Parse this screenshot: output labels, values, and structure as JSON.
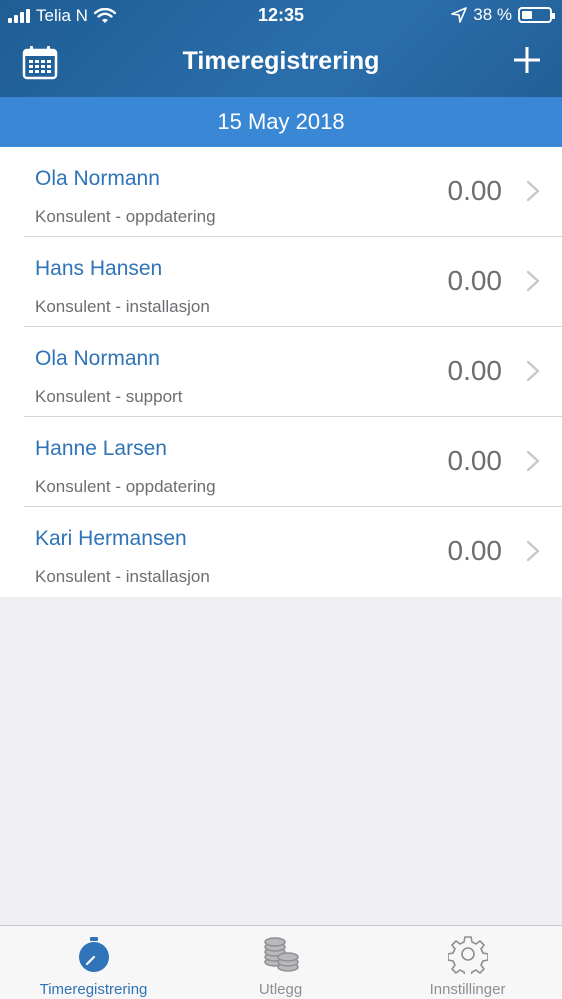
{
  "status_bar": {
    "carrier": "Telia N",
    "time": "12:35",
    "battery_text": "38 %",
    "battery_level": 0.38
  },
  "navbar": {
    "title": "Timeregistrering",
    "calendar_icon": "calendar-icon",
    "add_icon": "plus-icon"
  },
  "date_bar": {
    "date": "15 May 2018"
  },
  "entries": [
    {
      "name": "Ola Normann",
      "description": "Konsulent - oppdatering",
      "hours": "0.00"
    },
    {
      "name": "Hans Hansen",
      "description": "Konsulent - installasjon",
      "hours": "0.00"
    },
    {
      "name": "Ola Normann",
      "description": "Konsulent - support",
      "hours": "0.00"
    },
    {
      "name": "Hanne Larsen",
      "description": "Konsulent - oppdatering",
      "hours": "0.00"
    },
    {
      "name": "Kari Hermansen",
      "description": "Konsulent - installasjon",
      "hours": "0.00"
    }
  ],
  "tabs": [
    {
      "label": "Timeregistrering",
      "icon": "stopwatch-icon",
      "active": true
    },
    {
      "label": "Utlegg",
      "icon": "coins-icon",
      "active": false
    },
    {
      "label": "Innstillinger",
      "icon": "gear-icon",
      "active": false
    }
  ],
  "colors": {
    "header": "#235f97",
    "date_bar": "#3a87d6",
    "accent": "#2f73b8",
    "background": "#efeff4"
  }
}
